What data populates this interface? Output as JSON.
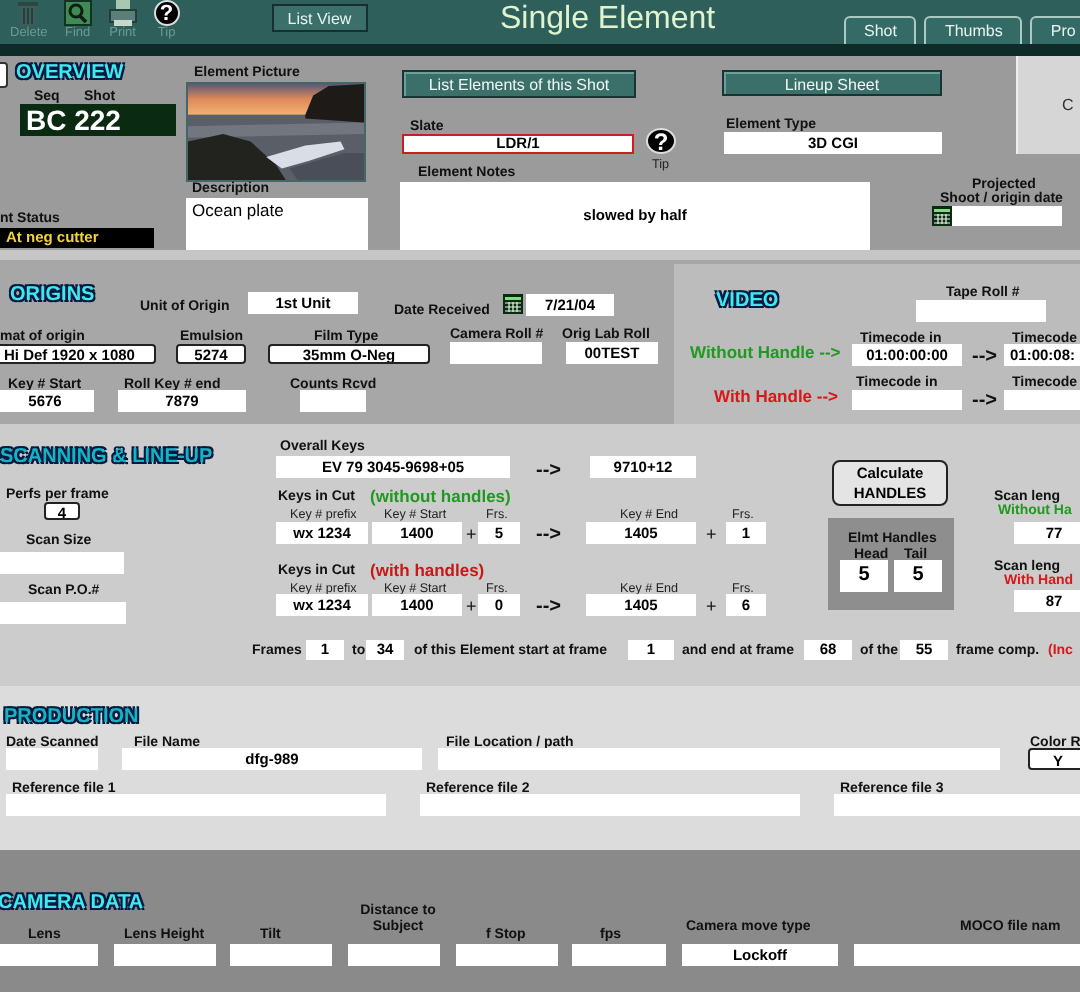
{
  "toolbar": {
    "tools": [
      {
        "kind": "trash",
        "label": "Delete"
      },
      {
        "kind": "find",
        "label": "Find"
      },
      {
        "kind": "print",
        "label": "Print"
      },
      {
        "kind": "tip",
        "label": "Tip",
        "symbol": "?"
      }
    ],
    "list_view": "List View",
    "title": "Single Element",
    "tabs": [
      {
        "label": "Shot",
        "selected": false
      },
      {
        "label": "Thumbs",
        "selected": false
      },
      {
        "label": "Pro",
        "selected": false
      }
    ]
  },
  "sections": [
    {
      "items": [
        {
          "kind": "checkbox",
          "checked": false
        },
        {
          "kind": "heading",
          "text": "OVERVIEW"
        },
        {
          "kind": "label",
          "text": "Seq"
        },
        {
          "kind": "label",
          "text": "Shot"
        },
        {
          "kind": "dark-field",
          "value": "BC 222"
        },
        {
          "kind": "label",
          "text": "nt Status"
        },
        {
          "kind": "status-field",
          "value": "At neg cutter"
        },
        {
          "kind": "label",
          "text": "Element Picture"
        },
        {
          "kind": "picture"
        },
        {
          "kind": "label",
          "text": "Description"
        },
        {
          "kind": "text-area",
          "value": "Ocean plate"
        },
        {
          "kind": "button",
          "text": "List Elements of this Shot"
        },
        {
          "kind": "button",
          "text": "Lineup Sheet"
        },
        {
          "kind": "panel",
          "text": "C"
        },
        {
          "kind": "label",
          "text": "Slate"
        },
        {
          "kind": "slate-field",
          "value": "LDR/1"
        },
        {
          "kind": "tip",
          "symbol": "?"
        },
        {
          "kind": "small-label",
          "text": "Tip"
        },
        {
          "kind": "label",
          "text": "Element Type"
        },
        {
          "kind": "field",
          "value": "3D CGI"
        },
        {
          "kind": "label",
          "text": "Element Notes"
        },
        {
          "kind": "field",
          "value": "slowed by half"
        },
        {
          "kind": "label",
          "text": "Projected"
        },
        {
          "kind": "label",
          "text": "Shoot / origin date"
        },
        {
          "kind": "calendar"
        },
        {
          "kind": "field"
        }
      ]
    },
    {
      "items": [
        {
          "kind": "subpanel"
        },
        {
          "kind": "heading",
          "text": "ORIGINS"
        },
        {
          "kind": "label",
          "text": "Unit of Origin"
        },
        {
          "kind": "field",
          "value": "1st Unit"
        },
        {
          "kind": "label",
          "text": "Date Received"
        },
        {
          "kind": "calendar"
        },
        {
          "kind": "field",
          "value": "7/21/04"
        },
        {
          "kind": "label",
          "text": "mat of origin"
        },
        {
          "kind": "dropdown",
          "value": "Hi Def 1920 x 1080"
        },
        {
          "kind": "label",
          "text": "Emulsion"
        },
        {
          "kind": "dropdown",
          "value": "5274"
        },
        {
          "kind": "label",
          "text": "Film Type"
        },
        {
          "kind": "dropdown",
          "value": "35mm O-Neg"
        },
        {
          "kind": "label",
          "text": "Camera Roll #"
        },
        {
          "kind": "field"
        },
        {
          "kind": "label",
          "text": "Orig Lab Roll"
        },
        {
          "kind": "field",
          "value": "00TEST"
        },
        {
          "kind": "label",
          "text": "Key # Start"
        },
        {
          "kind": "field",
          "value": "5676"
        },
        {
          "kind": "label",
          "text": "Roll Key # end"
        },
        {
          "kind": "field",
          "value": "7879"
        },
        {
          "kind": "label",
          "text": "Counts Rcvd"
        },
        {
          "kind": "field"
        },
        {
          "kind": "heading",
          "text": "VIDEO"
        },
        {
          "kind": "label",
          "text": "Tape Roll #"
        },
        {
          "kind": "field"
        },
        {
          "kind": "big-label",
          "text": "Without Handle -->",
          "color": "#1f9a1f"
        },
        {
          "kind": "label",
          "text": "Timecode in"
        },
        {
          "kind": "field",
          "value": "01:00:00:00"
        },
        {
          "kind": "arrow",
          "text": "-->"
        },
        {
          "kind": "label",
          "text": "Timecode"
        },
        {
          "kind": "field",
          "value": "01:00:08:"
        },
        {
          "kind": "big-label",
          "text": "With Handle -->",
          "color": "#d81818"
        },
        {
          "kind": "label",
          "text": "Timecode in"
        },
        {
          "kind": "field"
        },
        {
          "kind": "arrow",
          "text": "-->"
        },
        {
          "kind": "label",
          "text": "Timecode"
        },
        {
          "kind": "field"
        }
      ]
    },
    {
      "items": [
        {
          "kind": "heading",
          "text": "SCANNING & LINE-UP"
        },
        {
          "kind": "label",
          "text": "Perfs per frame"
        },
        {
          "kind": "dropdown",
          "value": "4"
        },
        {
          "kind": "label",
          "text": "Scan Size"
        },
        {
          "kind": "field"
        },
        {
          "kind": "label",
          "text": "Scan P.O.#"
        },
        {
          "kind": "field"
        },
        {
          "kind": "label",
          "text": "Overall Keys"
        },
        {
          "kind": "field",
          "value": "EV 79 3045-9698+05"
        },
        {
          "kind": "arrow",
          "text": "-->"
        },
        {
          "kind": "field",
          "value": "9710+12"
        },
        {
          "kind": "label",
          "text": "Keys in Cut"
        },
        {
          "kind": "big-label",
          "text": "(without handles)",
          "color": "#1f9a1f"
        },
        {
          "kind": "small-label",
          "text": "Key # prefix"
        },
        {
          "kind": "small-label",
          "text": "Key # Start"
        },
        {
          "kind": "small-label",
          "text": "Frs."
        },
        {
          "kind": "small-label",
          "text": "Key # End"
        },
        {
          "kind": "small-label",
          "text": "Frs."
        },
        {
          "kind": "field",
          "value": "wx 1234"
        },
        {
          "kind": "field",
          "value": "1400"
        },
        {
          "kind": "plus",
          "text": "+"
        },
        {
          "kind": "field",
          "value": "5"
        },
        {
          "kind": "arrow",
          "text": "-->"
        },
        {
          "kind": "field",
          "value": "1405"
        },
        {
          "kind": "plus",
          "text": "+"
        },
        {
          "kind": "field",
          "value": "1"
        },
        {
          "kind": "label",
          "text": "Keys in Cut"
        },
        {
          "kind": "big-label",
          "text": "(with handles)",
          "color": "#c81818"
        },
        {
          "kind": "small-label",
          "text": "Key # prefix"
        },
        {
          "kind": "small-label",
          "text": "Key # Start"
        },
        {
          "kind": "small-label",
          "text": "Frs."
        },
        {
          "kind": "small-label",
          "text": "Key # End"
        },
        {
          "kind": "small-label",
          "text": "Frs."
        },
        {
          "kind": "field",
          "value": "wx 1234"
        },
        {
          "kind": "field",
          "value": "1400"
        },
        {
          "kind": "plus",
          "text": "+"
        },
        {
          "kind": "field",
          "value": "0"
        },
        {
          "kind": "arrow",
          "text": "-->"
        },
        {
          "kind": "field",
          "value": "1405"
        },
        {
          "kind": "plus",
          "text": "+"
        },
        {
          "kind": "field",
          "value": "6"
        },
        {
          "kind": "round-button",
          "text": "Calculate HANDLES"
        },
        {
          "kind": "subpanel-dark"
        },
        {
          "kind": "label",
          "text": "Elmt Handles"
        },
        {
          "kind": "label",
          "text": "Head"
        },
        {
          "kind": "label",
          "text": "Tail"
        },
        {
          "kind": "big-field",
          "value": "5"
        },
        {
          "kind": "big-field",
          "value": "5"
        },
        {
          "kind": "label",
          "text": "Scan leng"
        },
        {
          "kind": "label",
          "text": "Without Ha",
          "color": "#1f9a1f"
        },
        {
          "kind": "field",
          "value": "77"
        },
        {
          "kind": "label",
          "text": "Scan leng"
        },
        {
          "kind": "label",
          "text": "With Hand",
          "color": "#d81818"
        },
        {
          "kind": "field",
          "value": "87"
        },
        {
          "kind": "label",
          "text": "Frames"
        },
        {
          "kind": "field",
          "value": "1"
        },
        {
          "kind": "label",
          "text": "to"
        },
        {
          "kind": "field",
          "value": "34"
        },
        {
          "kind": "label",
          "text": "of this Element start at frame"
        },
        {
          "kind": "field",
          "value": "1"
        },
        {
          "kind": "label",
          "text": "and end at frame"
        },
        {
          "kind": "field",
          "value": "68"
        },
        {
          "kind": "label",
          "text": "of the"
        },
        {
          "kind": "field",
          "value": "55"
        },
        {
          "kind": "label",
          "text": "frame comp."
        },
        {
          "kind": "label",
          "text": "(Inc",
          "color": "#d81818"
        }
      ]
    },
    {
      "items": [
        {
          "kind": "heading",
          "text": "PRODUCTION"
        },
        {
          "kind": "label",
          "text": "Date Scanned"
        },
        {
          "kind": "field"
        },
        {
          "kind": "label",
          "text": "File Name"
        },
        {
          "kind": "field",
          "value": "dfg-989"
        },
        {
          "kind": "label",
          "text": "File Location / path"
        },
        {
          "kind": "field"
        },
        {
          "kind": "label",
          "text": "Color R"
        },
        {
          "kind": "dropdown",
          "value": "Y"
        },
        {
          "kind": "label",
          "text": "Reference file 1"
        },
        {
          "kind": "field"
        },
        {
          "kind": "label",
          "text": "Reference file 2"
        },
        {
          "kind": "field"
        },
        {
          "kind": "label",
          "text": "Reference file 3"
        },
        {
          "kind": "field"
        }
      ]
    },
    {
      "items": [
        {
          "kind": "heading",
          "text": "CAMERA DATA"
        },
        {
          "kind": "label",
          "text": "Lens"
        },
        {
          "kind": "label",
          "text": "Lens Height"
        },
        {
          "kind": "label",
          "text": "Tilt"
        },
        {
          "kind": "label",
          "text": "Distance to Subject"
        },
        {
          "kind": "label",
          "text": "f Stop"
        },
        {
          "kind": "label",
          "text": "fps"
        },
        {
          "kind": "label",
          "text": "Camera move type"
        },
        {
          "kind": "label",
          "text": "MOCO file nam"
        },
        {
          "kind": "field"
        },
        {
          "kind": "field"
        },
        {
          "kind": "field"
        },
        {
          "kind": "field"
        },
        {
          "kind": "field"
        },
        {
          "kind": "field"
        },
        {
          "kind": "field",
          "value": "Lockoff"
        },
        {
          "kind": "field"
        }
      ]
    }
  ]
}
